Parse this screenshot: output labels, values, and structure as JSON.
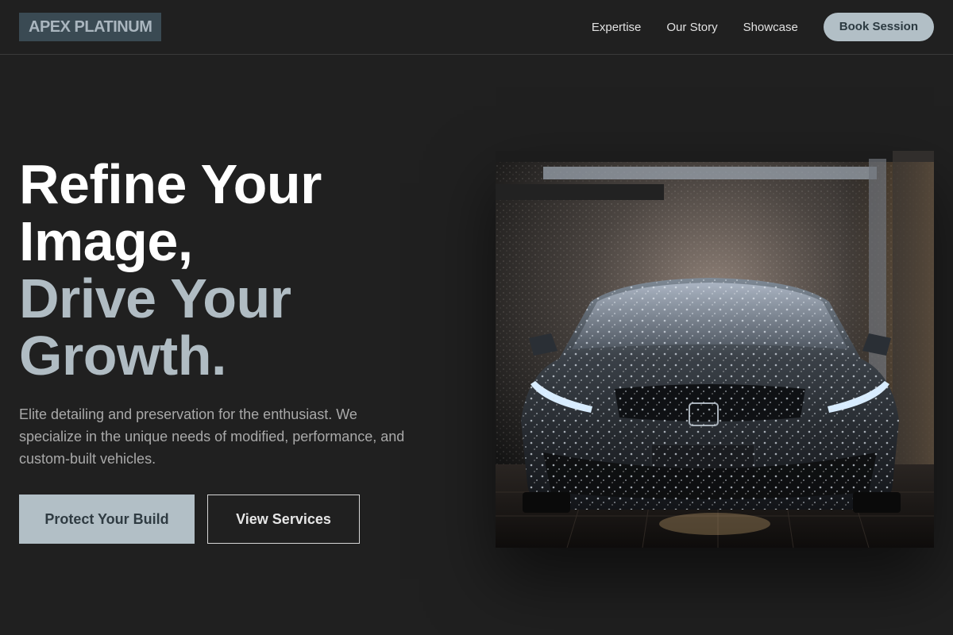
{
  "nav": {
    "logo": "APEX PLATINUM",
    "links": [
      "Expertise",
      "Our Story",
      "Showcase"
    ],
    "cta": "Book Session"
  },
  "hero": {
    "title_lines": [
      "Refine Your",
      "Image,",
      "Drive Your",
      "Growth."
    ],
    "description": "Elite detailing and preservation for the enthusiast. We specialize in the unique needs of modified, performance, and custom-built vehicles.",
    "primary_button": "Protect Your Build",
    "secondary_button": "View Services"
  },
  "colors": {
    "background": "#202020",
    "accent": "#b2bfc6",
    "logo_bg": "#3a4a53",
    "text_muted": "#a9a9a9"
  }
}
